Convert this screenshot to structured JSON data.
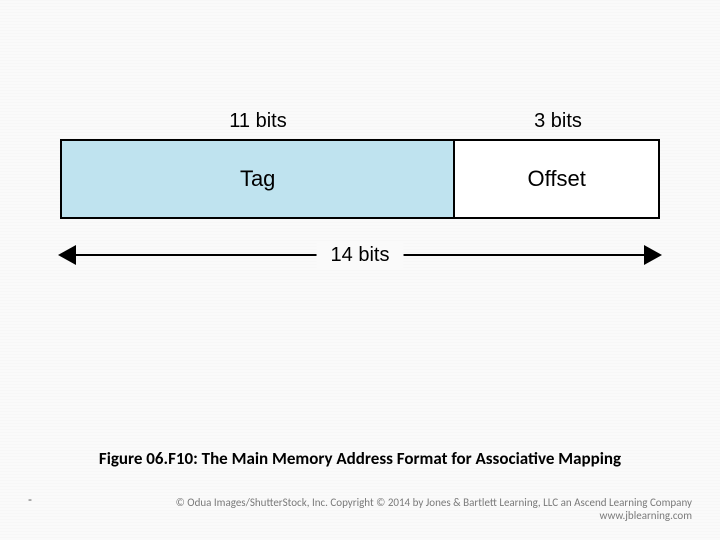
{
  "diagram": {
    "top_labels": {
      "tag_bits": "11 bits",
      "offset_bits": "3 bits"
    },
    "fields": {
      "tag": "Tag",
      "offset": "Offset"
    },
    "total_bits": "14 bits"
  },
  "caption": "Figure 06.F10: The Main Memory Address Format for Associative Mapping",
  "footer": {
    "copyright": "© Odua Images/ShutterStock, Inc. Copyright © 2014 by Jones & Bartlett Learning, LLC an Ascend Learning Company",
    "url": "www.jblearning.com"
  },
  "dash": "-",
  "chart_data": {
    "type": "table",
    "title": "Main Memory Address Format for Associative Mapping",
    "fields": [
      {
        "name": "Tag",
        "bits": 11
      },
      {
        "name": "Offset",
        "bits": 3
      }
    ],
    "total_bits": 14
  }
}
